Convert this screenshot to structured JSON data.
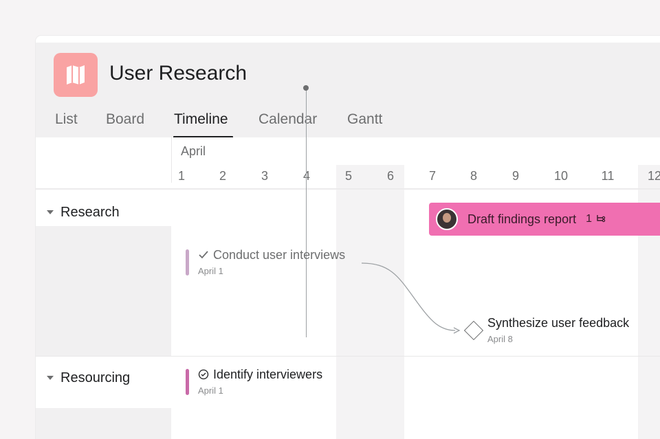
{
  "project": {
    "title": "User Research",
    "icon": "map-icon",
    "icon_color": "#f9a3a3"
  },
  "tabs": [
    {
      "label": "List"
    },
    {
      "label": "Board"
    },
    {
      "label": "Timeline"
    },
    {
      "label": "Calendar"
    },
    {
      "label": "Gantt"
    }
  ],
  "active_tab": "Timeline",
  "timeline": {
    "month": "April",
    "days": [
      "1",
      "2",
      "3",
      "4",
      "5",
      "6",
      "7",
      "8",
      "9",
      "10",
      "11",
      "12"
    ],
    "today": "4"
  },
  "sections": [
    {
      "name": "Research"
    },
    {
      "name": "Resourcing"
    }
  ],
  "tasks": {
    "draft": {
      "name": "Draft findings report",
      "subtask_count": "1",
      "color": "#f06fb1"
    },
    "interviews": {
      "name": "Conduct user interviews",
      "date": "April 1",
      "status": "completed"
    },
    "synthesize": {
      "name": "Synthesize user feedback",
      "date": "April 8",
      "type": "milestone"
    },
    "identify": {
      "name": "Identify interviewers",
      "date": "April 1",
      "status": "incomplete"
    }
  }
}
